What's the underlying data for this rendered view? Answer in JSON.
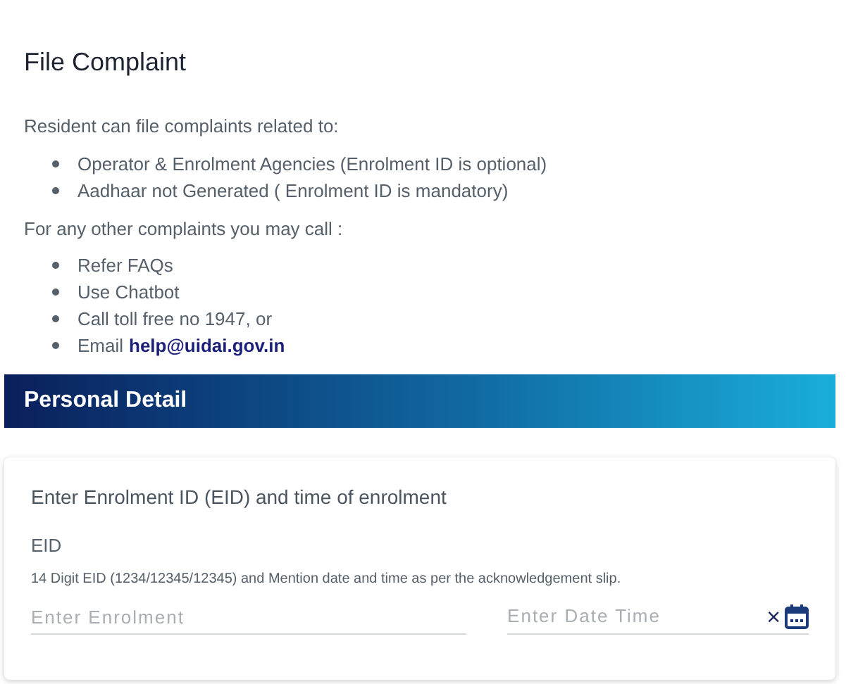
{
  "title": "File Complaint",
  "intro": "Resident can file complaints related to:",
  "complaint_types": [
    "Operator & Enrolment Agencies (Enrolment ID is optional)",
    "Aadhaar not Generated ( Enrolment ID is mandatory)"
  ],
  "other_intro": "For any other complaints you may call :",
  "other_options": [
    {
      "text": "Refer FAQs"
    },
    {
      "text": "Use Chatbot"
    },
    {
      "text": "Call toll free no 1947, or"
    },
    {
      "text": "Email",
      "link": "help@uidai.gov.in"
    }
  ],
  "section_header": "Personal Detail",
  "form": {
    "heading": "Enter Enrolment ID (EID) and time of enrolment",
    "label": "EID",
    "hint": "14 Digit EID (1234/12345/12345) and Mention date and time as per the acknowledgement slip.",
    "eid_field": {
      "placeholder": "Enter Enrolment"
    },
    "date_field": {
      "placeholder": "Enter Date Time",
      "clear": "×"
    }
  }
}
